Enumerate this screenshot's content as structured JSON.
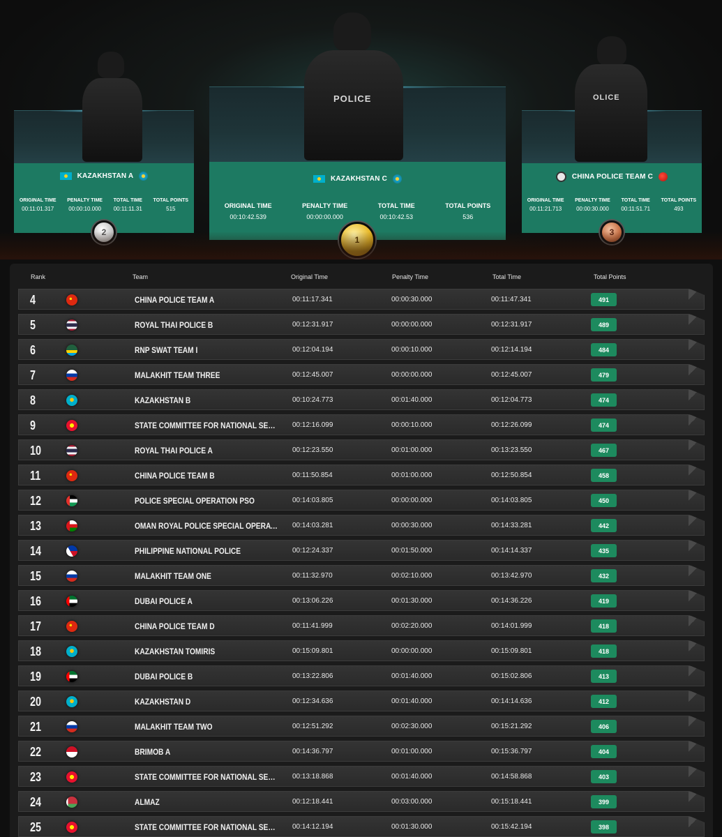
{
  "podium": [
    {
      "place": "2",
      "team": "KAZAKHSTAN A",
      "flag": "kazakhstan",
      "emblem": "kazakhstan-emblem",
      "vest_text": "",
      "original_time": "00:11:01.317",
      "penalty_time": "00:00:10.000",
      "total_time": "00:11:11.31",
      "total_points": "515",
      "medal": "silver"
    },
    {
      "place": "1",
      "team": "KAZAKHSTAN C",
      "flag": "kazakhstan",
      "emblem": "kazakhstan-emblem",
      "vest_text": "POLICE",
      "original_time": "00:10:42.539",
      "penalty_time": "00:00:00.000",
      "total_time": "00:10:42.53",
      "total_points": "536",
      "medal": "gold"
    },
    {
      "place": "3",
      "team": "CHINA POLICE TEAM C",
      "flag": "police-emblem",
      "emblem": "china-emblem",
      "vest_text": "OLICE",
      "original_time": "00:11:21.713",
      "penalty_time": "00:00:30.000",
      "total_time": "00:11:51.71",
      "total_points": "493",
      "medal": "bronze"
    }
  ],
  "stat_labels": {
    "original_time": "ORIGINAL TIME",
    "penalty_time": "PENALTY TIME",
    "total_time": "TOTAL TIME",
    "total_points": "TOTAL POINTS"
  },
  "table": {
    "headers": {
      "rank": "Rank",
      "team": "Team",
      "original_time": "Original Time",
      "penalty_time": "Penalty Time",
      "total_time": "Total Time",
      "total_points": "Total Points"
    },
    "rows": [
      {
        "rank": "4",
        "flag": "china",
        "team": "CHINA POLICE TEAM A",
        "original_time": "00:11:17.341",
        "penalty_time": "00:00:30.000",
        "total_time": "00:11:47.341",
        "points": "491"
      },
      {
        "rank": "5",
        "flag": "thailand",
        "team": "ROYAL THAI POLICE B",
        "original_time": "00:12:31.917",
        "penalty_time": "00:00:00.000",
        "total_time": "00:12:31.917",
        "points": "489"
      },
      {
        "rank": "6",
        "flag": "rwanda",
        "team": "RNP SWAT TEAM I",
        "original_time": "00:12:04.194",
        "penalty_time": "00:00:10.000",
        "total_time": "00:12:14.194",
        "points": "484"
      },
      {
        "rank": "7",
        "flag": "russia",
        "team": "MALAKHIT TEAM THREE",
        "original_time": "00:12:45.007",
        "penalty_time": "00:00:00.000",
        "total_time": "00:12:45.007",
        "points": "479"
      },
      {
        "rank": "8",
        "flag": "kazakhstan",
        "team": "KAZAKHSTAN B",
        "original_time": "00:10:24.773",
        "penalty_time": "00:01:40.000",
        "total_time": "00:12:04.773",
        "points": "474"
      },
      {
        "rank": "9",
        "flag": "kyrgyzstan",
        "team": "STATE COMMITTEE FOR NATIONAL SECURITY OF...",
        "original_time": "00:12:16.099",
        "penalty_time": "00:00:10.000",
        "total_time": "00:12:26.099",
        "points": "474"
      },
      {
        "rank": "10",
        "flag": "thailand",
        "team": "ROYAL THAI POLICE A",
        "original_time": "00:12:23.550",
        "penalty_time": "00:01:00.000",
        "total_time": "00:13:23.550",
        "points": "467"
      },
      {
        "rank": "11",
        "flag": "china",
        "team": "CHINA POLICE TEAM B",
        "original_time": "00:11:50.854",
        "penalty_time": "00:01:00.000",
        "total_time": "00:12:50.854",
        "points": "458"
      },
      {
        "rank": "12",
        "flag": "palestine",
        "team": "POLICE SPECIAL OPERATION PSO",
        "original_time": "00:14:03.805",
        "penalty_time": "00:00:00.000",
        "total_time": "00:14:03.805",
        "points": "450"
      },
      {
        "rank": "13",
        "flag": "oman",
        "team": "OMAN ROYAL POLICE SPECIAL OPERATIONS...",
        "original_time": "00:14:03.281",
        "penalty_time": "00:00:30.000",
        "total_time": "00:14:33.281",
        "points": "442"
      },
      {
        "rank": "14",
        "flag": "philippines",
        "team": "PHILIPPINE NATIONAL POLICE",
        "original_time": "00:12:24.337",
        "penalty_time": "00:01:50.000",
        "total_time": "00:14:14.337",
        "points": "435"
      },
      {
        "rank": "15",
        "flag": "russia",
        "team": "MALAKHIT TEAM ONE",
        "original_time": "00:11:32.970",
        "penalty_time": "00:02:10.000",
        "total_time": "00:13:42.970",
        "points": "432"
      },
      {
        "rank": "16",
        "flag": "uae",
        "team": "DUBAI POLICE A",
        "original_time": "00:13:06.226",
        "penalty_time": "00:01:30.000",
        "total_time": "00:14:36.226",
        "points": "419"
      },
      {
        "rank": "17",
        "flag": "china",
        "team": "CHINA POLICE TEAM D",
        "original_time": "00:11:41.999",
        "penalty_time": "00:02:20.000",
        "total_time": "00:14:01.999",
        "points": "418"
      },
      {
        "rank": "18",
        "flag": "kazakhstan",
        "team": "KAZAKHSTAN TOMIRIS",
        "original_time": "00:15:09.801",
        "penalty_time": "00:00:00.000",
        "total_time": "00:15:09.801",
        "points": "418"
      },
      {
        "rank": "19",
        "flag": "uae",
        "team": "DUBAI POLICE B",
        "original_time": "00:13:22.806",
        "penalty_time": "00:01:40.000",
        "total_time": "00:15:02.806",
        "points": "413"
      },
      {
        "rank": "20",
        "flag": "kazakhstan",
        "team": "KAZAKHSTAN D",
        "original_time": "00:12:34.636",
        "penalty_time": "00:01:40.000",
        "total_time": "00:14:14.636",
        "points": "412"
      },
      {
        "rank": "21",
        "flag": "russia",
        "team": "MALAKHIT TEAM TWO",
        "original_time": "00:12:51.292",
        "penalty_time": "00:02:30.000",
        "total_time": "00:15:21.292",
        "points": "406"
      },
      {
        "rank": "22",
        "flag": "indonesia",
        "team": "BRIMOB A",
        "original_time": "00:14:36.797",
        "penalty_time": "00:01:00.000",
        "total_time": "00:15:36.797",
        "points": "404"
      },
      {
        "rank": "23",
        "flag": "kyrgyzstan",
        "team": "STATE COMMITTEE FOR NATIONAL SECURITY OF...",
        "original_time": "00:13:18.868",
        "penalty_time": "00:01:40.000",
        "total_time": "00:14:58.868",
        "points": "403"
      },
      {
        "rank": "24",
        "flag": "belarus",
        "team": "ALMAZ",
        "original_time": "00:12:18.441",
        "penalty_time": "00:03:00.000",
        "total_time": "00:15:18.441",
        "points": "399"
      },
      {
        "rank": "25",
        "flag": "kyrgyzstan",
        "team": "STATE COMMITTEE FOR NATIONAL SECURITY OF...",
        "original_time": "00:14:12.194",
        "penalty_time": "00:01:30.000",
        "total_time": "00:15:42.194",
        "points": "398"
      }
    ]
  },
  "colors": {
    "panel_green": "#1d7a62",
    "points_green": "#1d8a5e",
    "row_bg": "#2e2e2e",
    "board_bg": "#1b1b1b"
  }
}
